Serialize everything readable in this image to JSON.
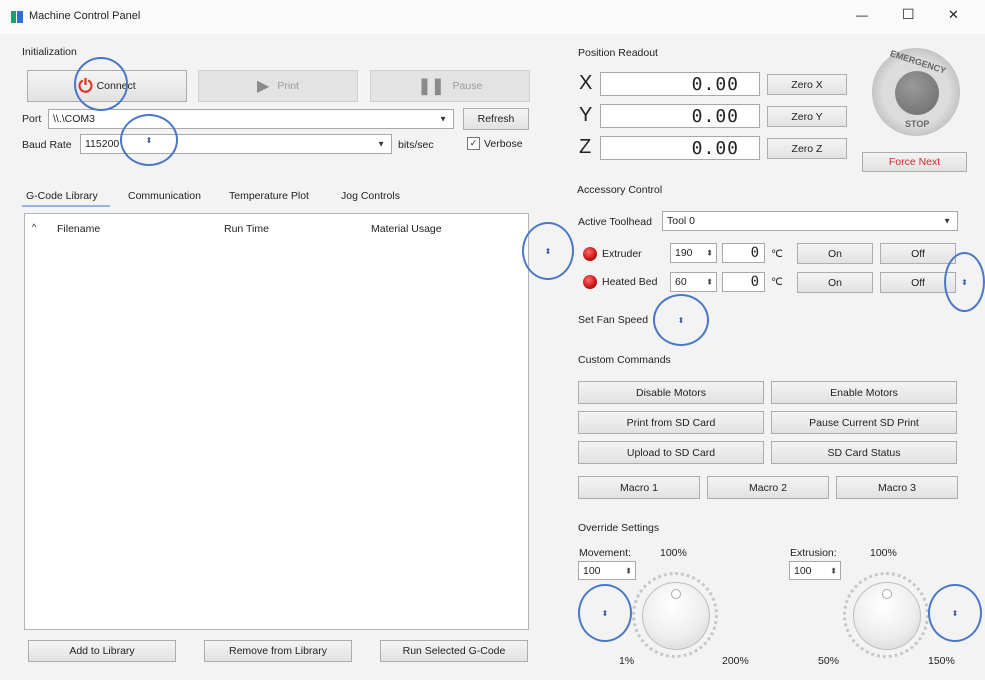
{
  "window": {
    "title": "Machine Control Panel",
    "minimize": "—",
    "maximize": "☐",
    "close": "✕"
  },
  "init": {
    "section": "Initialization",
    "connect": "Connect",
    "print": "Print",
    "pause": "Pause",
    "port_label": "Port",
    "port_value": "\\\\.\\COM3",
    "refresh": "Refresh",
    "baud_label": "Baud Rate",
    "baud_value": "115200",
    "baud_unit": "bits/sec",
    "verbose": "Verbose"
  },
  "tabs": [
    "G-Code Library",
    "Communication",
    "Temperature Plot",
    "Jog Controls"
  ],
  "library": {
    "columns": [
      "Filename",
      "Run Time",
      "Material Usage"
    ],
    "add": "Add to Library",
    "remove": "Remove from Library",
    "run": "Run Selected G-Code"
  },
  "position": {
    "section": "Position Readout",
    "axes": [
      {
        "axis": "X",
        "value": "0.00",
        "button": "Zero X"
      },
      {
        "axis": "Y",
        "value": "0.00",
        "button": "Zero Y"
      },
      {
        "axis": "Z",
        "value": "0.00",
        "button": "Zero Z"
      }
    ]
  },
  "estop": {
    "top": "EMERGENCY",
    "bottom": "STOP",
    "force_next": "Force Next"
  },
  "accessory": {
    "section": "Accessory Control",
    "toolhead_label": "Active Toolhead",
    "toolhead_value": "Tool 0",
    "rows": [
      {
        "label": "Extruder",
        "set": "190",
        "reading": "0",
        "unit": "℃",
        "on": "On",
        "off": "Off"
      },
      {
        "label": "Heated Bed",
        "set": "60",
        "reading": "0",
        "unit": "℃",
        "on": "On",
        "off": "Off"
      }
    ],
    "fan_label": "Set Fan Speed"
  },
  "custom": {
    "section": "Custom Commands",
    "buttons": [
      "Disable Motors",
      "Enable Motors",
      "Print from SD Card",
      "Pause Current SD Print",
      "Upload to SD Card",
      "SD Card Status"
    ],
    "macros": [
      "Macro 1",
      "Macro 2",
      "Macro 3"
    ]
  },
  "override": {
    "section": "Override Settings",
    "movement_label": "Movement:",
    "movement_pct": "100%",
    "movement_value": "100",
    "movement_min": "1%",
    "movement_max": "200%",
    "extrusion_label": "Extrusion:",
    "extrusion_pct": "100%",
    "extrusion_value": "100",
    "extrusion_min": "50%",
    "extrusion_max": "150%"
  },
  "accent_colors": {
    "power": "#e0301e",
    "status_red": "#c41414",
    "annotation": "#4a78c8"
  }
}
